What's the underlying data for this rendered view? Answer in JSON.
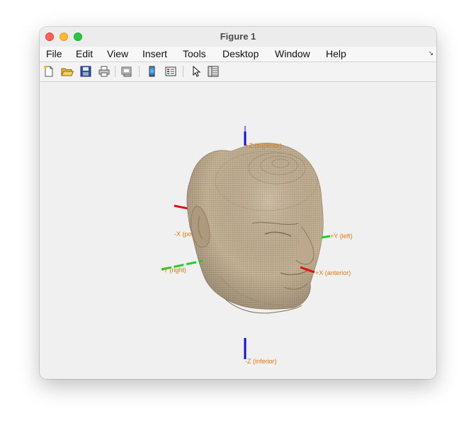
{
  "window": {
    "title": "Figure 1"
  },
  "menu": {
    "items": [
      "File",
      "Edit",
      "View",
      "Insert",
      "Tools",
      "Desktop",
      "Window",
      "Help"
    ]
  },
  "toolbar": {
    "icons": [
      "new-figure-icon",
      "open-file-icon",
      "save-icon",
      "print-icon",
      "link-plot-icon",
      "insert-colorbar-icon",
      "insert-legend-icon",
      "edit-plot-icon",
      "property-inspector-icon"
    ]
  },
  "figure": {
    "axes_labels": {
      "z_superior": "+Z (superior)",
      "y_left": "+Y (left)",
      "x_anterior": "+X (anterior)",
      "x_posterior": "-X (po",
      "y_right": "-Y (right)",
      "z_inferior": "-Z (inferior)"
    },
    "colors": {
      "surface": "#b9a68a",
      "x_axis": "#e01010",
      "y_axis": "#20d020",
      "z_axis": "#1010e0",
      "label": "#e07a10"
    }
  }
}
